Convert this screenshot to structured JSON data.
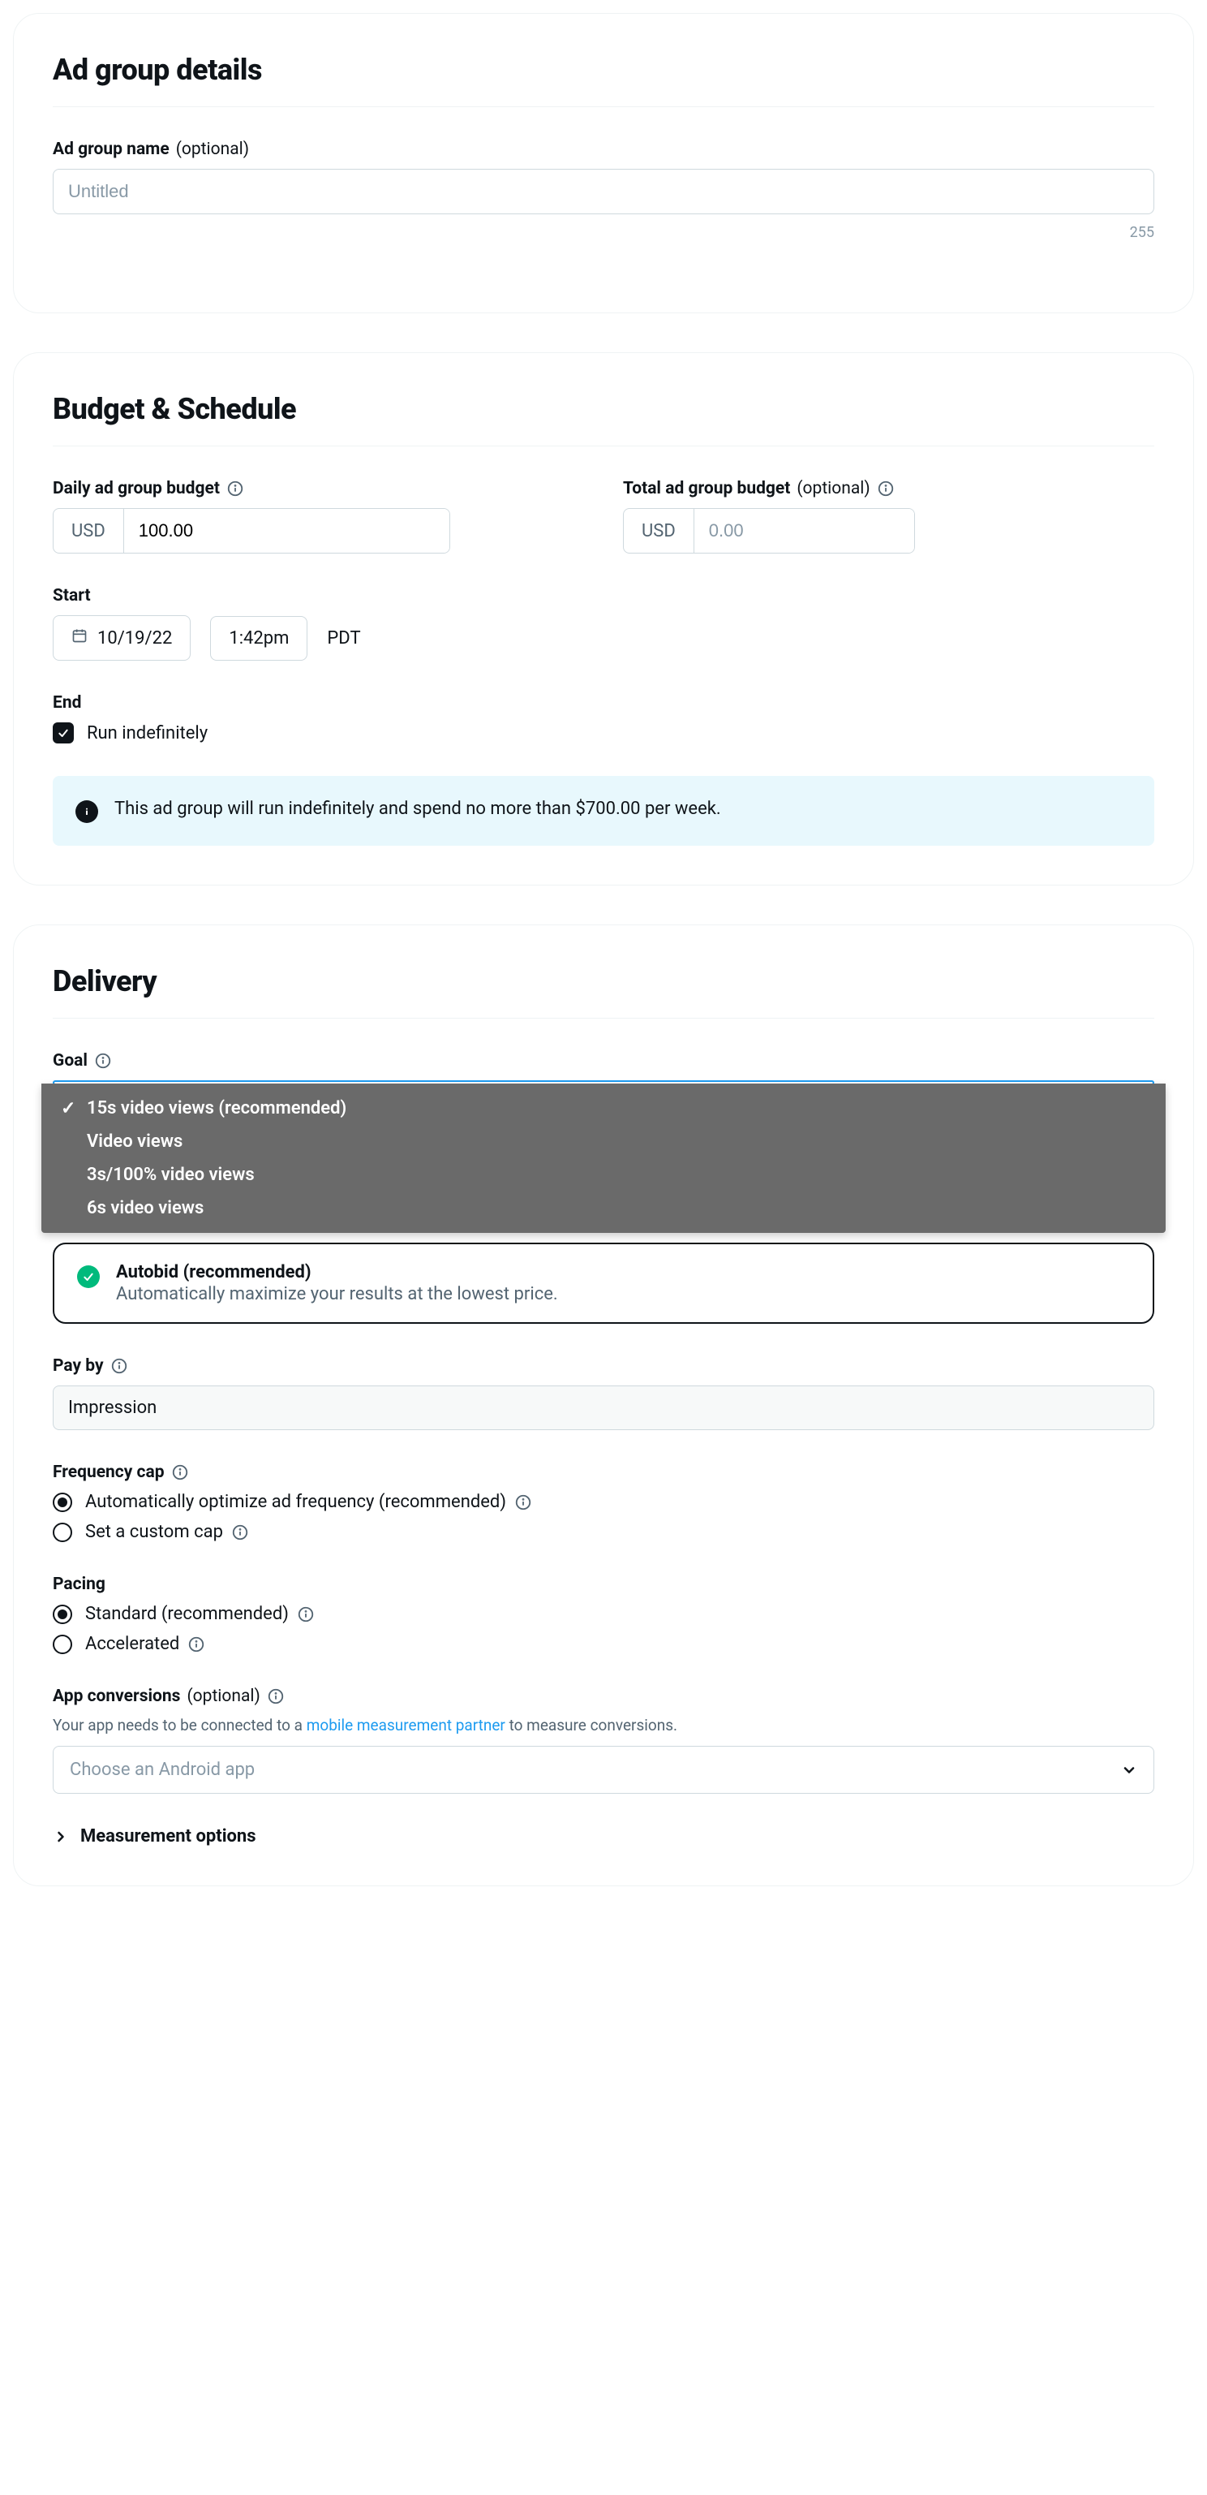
{
  "adGroup": {
    "title": "Ad group details",
    "nameLabel": "Ad group name",
    "optional": "(optional)",
    "namePlaceholder": "Untitled",
    "nameValue": "",
    "counter": "255"
  },
  "budget": {
    "title": "Budget & Schedule",
    "dailyLabel": "Daily ad group budget",
    "totalLabel": "Total ad group budget",
    "optional": "(optional)",
    "currency": "USD",
    "dailyValue": "100.00",
    "totalPlaceholder": "0.00",
    "startLabel": "Start",
    "startDate": "10/19/22",
    "startTime": "1:42pm",
    "timezone": "PDT",
    "endLabel": "End",
    "runIndefLabel": "Run indefinitely",
    "infoText": "This ad group will run indefinitely and spend no more than $700.00 per week."
  },
  "delivery": {
    "title": "Delivery",
    "goalLabel": "Goal",
    "goalOptions": [
      "15s video views (recommended)",
      "Video views",
      "3s/100% video views",
      "6s video views"
    ],
    "bid": {
      "title": "Autobid (recommended)",
      "sub": "Automatically maximize your results at the lowest price."
    },
    "payByLabel": "Pay by",
    "payByValue": "Impression",
    "freqLabel": "Frequency cap",
    "freqOpt1": "Automatically optimize ad frequency (recommended)",
    "freqOpt2": "Set a custom cap",
    "pacingLabel": "Pacing",
    "pacingOpt1": "Standard (recommended)",
    "pacingOpt2": "Accelerated",
    "appConvLabel": "App conversions",
    "optional": "(optional)",
    "appHelpPrefix": "Your app needs to be connected to a ",
    "appHelpLink": "mobile measurement partner",
    "appHelpSuffix": " to measure conversions.",
    "appPlaceholder": "Choose an Android app",
    "measurementLabel": "Measurement options"
  }
}
